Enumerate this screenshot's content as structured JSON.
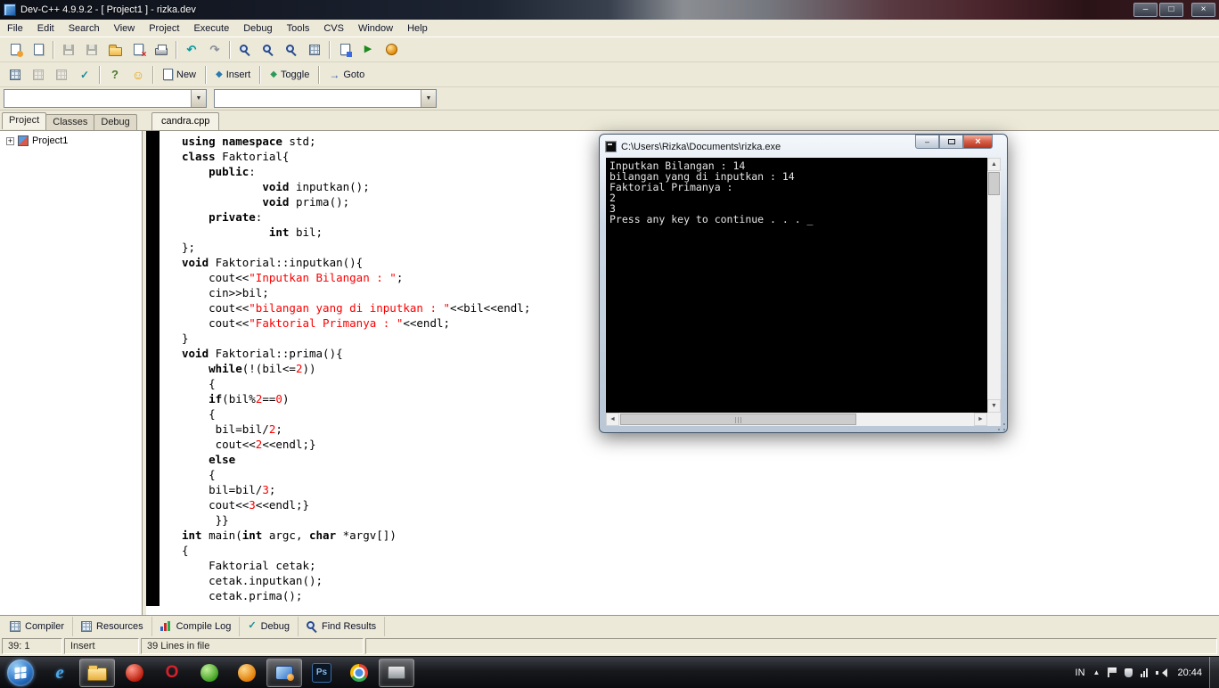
{
  "window": {
    "title": "Dev-C++ 4.9.9.2 -  [ Project1 ] - rizka.dev"
  },
  "menu_items": [
    "File",
    "Edit",
    "Search",
    "View",
    "Project",
    "Execute",
    "Debug",
    "Tools",
    "CVS",
    "Window",
    "Help"
  ],
  "specials_toolbar": {
    "new_label": "New",
    "insert_label": "Insert",
    "toggle_label": "Toggle",
    "goto_label": "Goto"
  },
  "left_panel": {
    "tabs": [
      "Project",
      "Classes",
      "Debug"
    ],
    "tree_root": "Project1",
    "expander": "+"
  },
  "editor": {
    "tab_label": "candra.cpp",
    "code_lines": [
      "using namespace std;",
      "class Faktorial{",
      "    public:",
      "            void inputkan();",
      "            void prima();",
      "    private:",
      "             int bil;",
      "};",
      "void Faktorial::inputkan(){",
      "    cout<<\"Inputkan Bilangan : \";",
      "    cin>>bil;",
      "    cout<<\"bilangan yang di inputkan : \"<<bil<<endl;",
      "    cout<<\"Faktorial Primanya : \"<<endl;",
      "}",
      "void Faktorial::prima(){",
      "    while(!(bil<=2))",
      "    {",
      "    if(bil%2==0)",
      "    {",
      "     bil=bil/2;",
      "     cout<<2<<endl;}",
      "    else",
      "    {",
      "    bil=bil/3;",
      "    cout<<3<<endl;}",
      "     }}",
      "int main(int argc, char *argv[])",
      "{",
      "    Faktorial cetak;",
      "    cetak.inputkan();",
      "    cetak.prima();"
    ]
  },
  "console": {
    "title": "C:\\Users\\Rizka\\Documents\\rizka.exe",
    "lines": [
      "Inputkan Bilangan : 14",
      "bilangan yang di inputkan : 14",
      "Faktorial Primanya :",
      "2",
      "3",
      "Press any key to continue . . . _"
    ]
  },
  "bottom_tabs": [
    "Compiler",
    "Resources",
    "Compile Log",
    "Debug",
    "Find Results"
  ],
  "statusbar": {
    "cursor": "39: 1",
    "mode": "Insert",
    "lines_info": "39 Lines in file"
  },
  "taskbar": {
    "language": "IN",
    "clock": "20:44",
    "photoshop_label": "Ps"
  },
  "icons": {
    "minimize": "–",
    "maximize": "□",
    "close": "×",
    "undo": "↶",
    "redo": "↷",
    "check": "✓",
    "help": "?",
    "smiley": "☺",
    "run": "▶",
    "diamond": "◆",
    "arrow_right": "→",
    "dropdown": "▼",
    "up": "▲",
    "down": "▼",
    "left": "◄",
    "right": "►",
    "chevron_up": "▲"
  },
  "syntax_colors": {
    "keyword": "#000000",
    "string": "#fa0000",
    "number": "#fa0000"
  }
}
